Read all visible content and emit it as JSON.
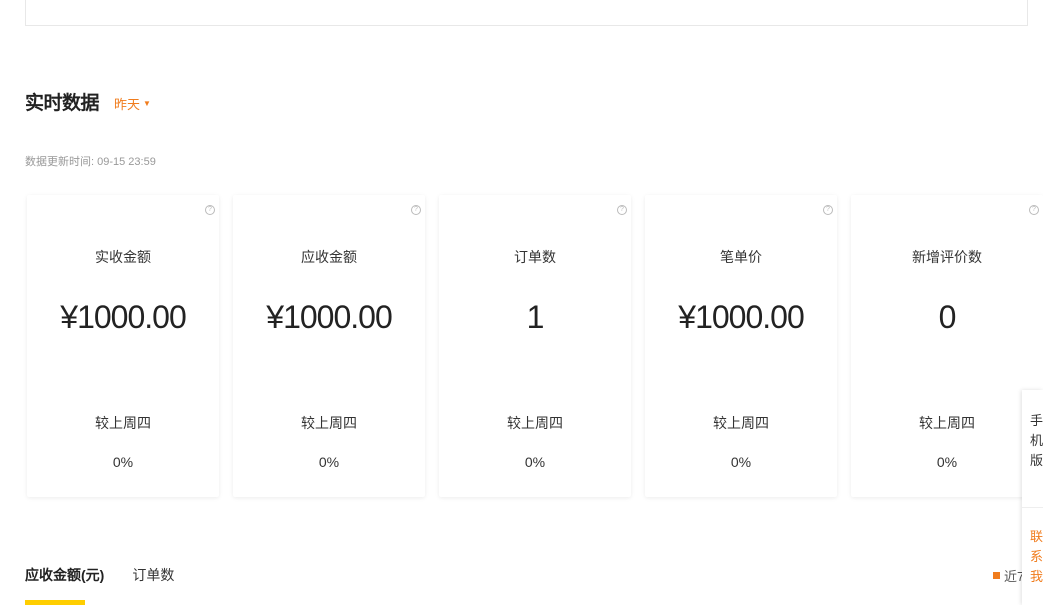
{
  "section": {
    "title": "实时数据",
    "period": "昨天"
  },
  "update_time": "数据更新时间: 09-15 23:59",
  "cards": [
    {
      "label": "实收金额",
      "value": "¥1000.00",
      "compare": "较上周四",
      "percent": "0%"
    },
    {
      "label": "应收金额",
      "value": "¥1000.00",
      "compare": "较上周四",
      "percent": "0%"
    },
    {
      "label": "订单数",
      "value": "1",
      "compare": "较上周四",
      "percent": "0%"
    },
    {
      "label": "笔单价",
      "value": "¥1000.00",
      "compare": "较上周四",
      "percent": "0%"
    },
    {
      "label": "新增评价数",
      "value": "0",
      "compare": "较上周四",
      "percent": "0%"
    }
  ],
  "help_icon_glyph": "?",
  "tabs": [
    {
      "label": "应收金额(元)",
      "active": true
    },
    {
      "label": "订单数",
      "active": false
    }
  ],
  "legend": {
    "label": "近7",
    "color": "#f07c1d"
  },
  "side_float": {
    "mobile": "手\n机\n版",
    "contact": "联\n系\n我"
  },
  "colors": {
    "accent": "#f07c1d",
    "tab_underline": "#ffce00"
  }
}
